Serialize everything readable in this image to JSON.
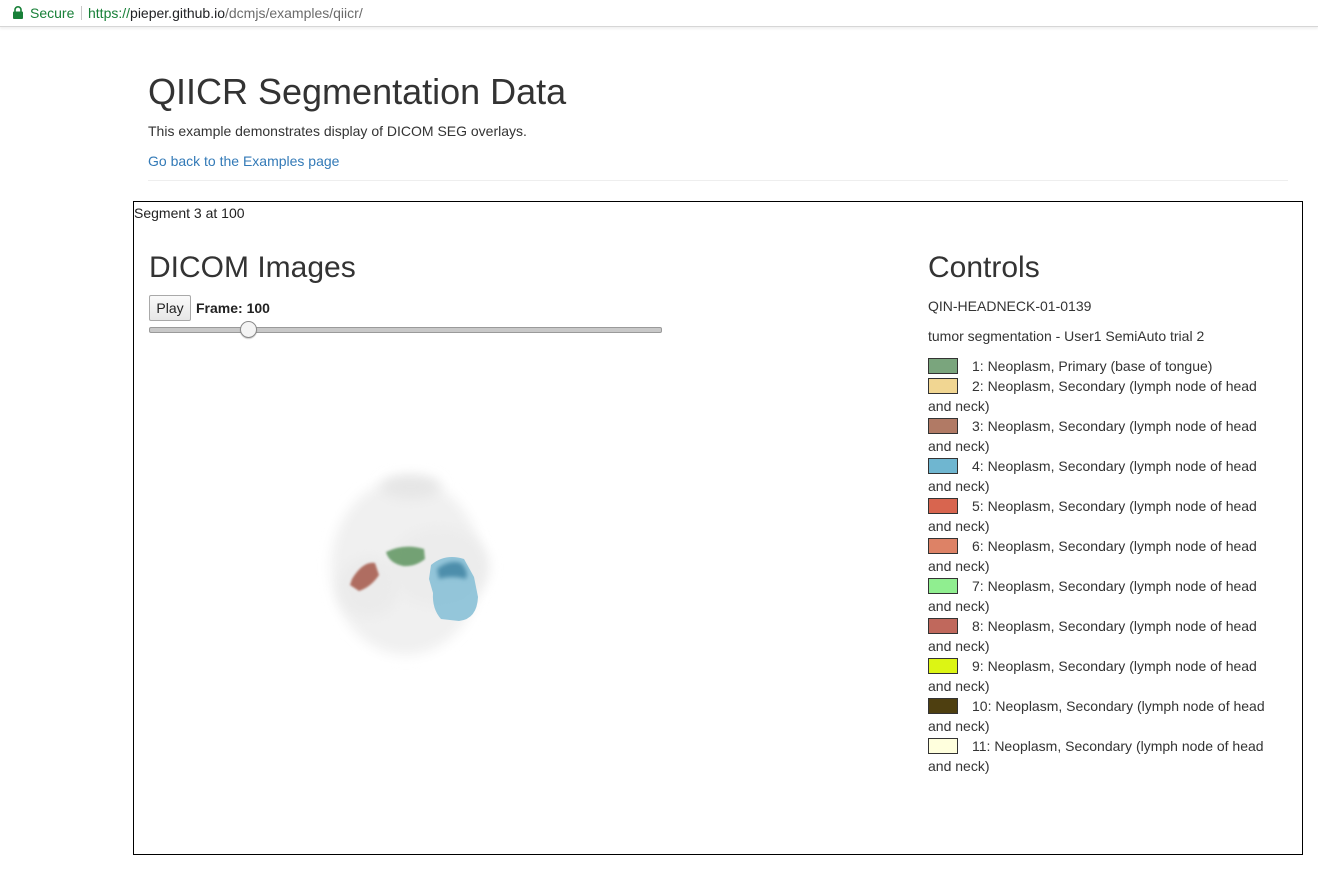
{
  "browser": {
    "secure_label": "Secure",
    "url_scheme": "https://",
    "url_host": "pieper.github.io",
    "url_path": "/dcmjs/examples/qiicr/"
  },
  "header": {
    "title": "QIICR Segmentation Data",
    "description": "This example demonstrates display of DICOM SEG overlays.",
    "back_link": "Go back to the Examples page"
  },
  "status_text": "Segment 3 at 100",
  "viewer": {
    "title": "DICOM Images",
    "play_label": "Play",
    "frame_label": "Frame: 100",
    "frame_value": 100
  },
  "controls": {
    "title": "Controls",
    "patient_id": "QIN-HEADNECK-01-0139",
    "series_description": "tumor segmentation - User1 SemiAuto trial 2",
    "segments": [
      {
        "label": "1: Neoplasm, Primary (base of tongue)",
        "color": "#7aa57d"
      },
      {
        "label": "2: Neoplasm, Secondary (lymph node of head and neck)",
        "color": "#f1d692"
      },
      {
        "label": "3: Neoplasm, Secondary (lymph node of head and neck)",
        "color": "#b17a65"
      },
      {
        "label": "4: Neoplasm, Secondary (lymph node of head and neck)",
        "color": "#6fb6d0"
      },
      {
        "label": "5: Neoplasm, Secondary (lymph node of head and neck)",
        "color": "#d8654f"
      },
      {
        "label": "6: Neoplasm, Secondary (lymph node of head and neck)",
        "color": "#dd8266"
      },
      {
        "label": "7: Neoplasm, Secondary (lymph node of head and neck)",
        "color": "#90ee90"
      },
      {
        "label": "8: Neoplasm, Secondary (lymph node of head and neck)",
        "color": "#c0685c"
      },
      {
        "label": "9: Neoplasm, Secondary (lymph node of head and neck)",
        "color": "#dcf514"
      },
      {
        "label": "10: Neoplasm, Secondary (lymph node of head and neck)",
        "color": "#4e3f10"
      },
      {
        "label": "11: Neoplasm, Secondary (lymph node of head and neck)",
        "color": "#ffffdd"
      }
    ]
  }
}
